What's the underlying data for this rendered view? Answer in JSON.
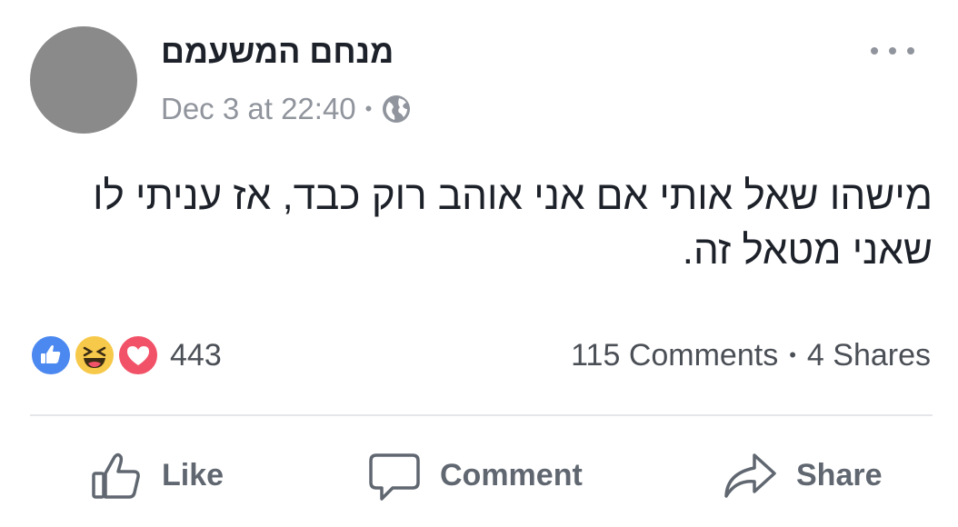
{
  "post": {
    "author": "מנחם המשעמם",
    "date": "Dec 3 at 22:40",
    "separator": "•",
    "text": "מישהו שאל אותי אם אני אוהב רוק כבד, אז עניתי לו שאני מטאל זה."
  },
  "reactions": {
    "icons": [
      "like-icon",
      "haha-icon",
      "love-icon"
    ],
    "count": "443"
  },
  "stats": {
    "comments": "115 Comments",
    "separator": "•",
    "shares": "4 Shares"
  },
  "actions": {
    "like_label": "Like",
    "comment_label": "Comment",
    "share_label": "Share"
  },
  "colors": {
    "like_blue": "#4b88f0",
    "haha_yellow": "#f7c94a",
    "love_red": "#f25268",
    "meta_gray": "#90949c",
    "action_gray": "#606770"
  }
}
